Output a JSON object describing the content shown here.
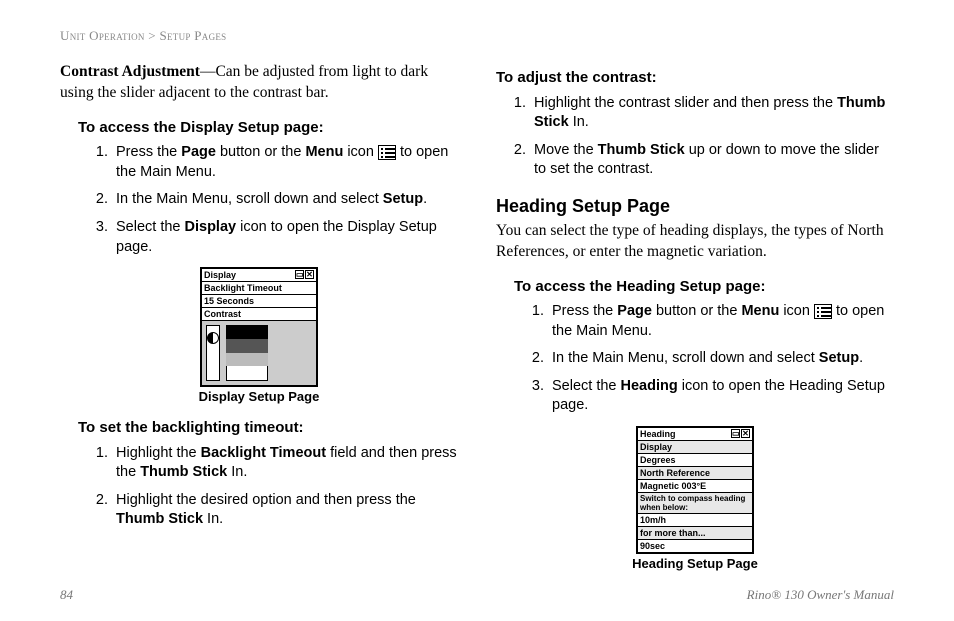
{
  "breadcrumb": {
    "a": "Unit Operation",
    "sep": " > ",
    "b": "Setup Pages"
  },
  "left": {
    "lead": "Contrast Adjustment",
    "lead_rest": "—Can be adjusted from light to dark using the slider adjacent to the contrast bar.",
    "proc1_head": "To access the Display Setup page:",
    "proc1": {
      "s1a": "Press the ",
      "s1b": "Page",
      "s1c": " button or the ",
      "s1d": "Menu",
      "s1e": " icon ",
      "s1f": " to open the Main Menu.",
      "s2a": "In the Main Menu, scroll down and select ",
      "s2b": "Setup",
      "s2c": ".",
      "s3a": "Select the ",
      "s3b": "Display",
      "s3c": " icon to open the Display Setup page."
    },
    "fig1_caption": "Display Setup Page",
    "display_mock": {
      "title": "Display",
      "row1": "Backlight Timeout",
      "row2": "15 Seconds",
      "row3": "Contrast"
    },
    "proc2_head": "To set the backlighting timeout:",
    "proc2": {
      "s1a": "Highlight the ",
      "s1b": "Backlight Timeout",
      "s1c": " field and then press the ",
      "s1d": "Thumb Stick",
      "s1e": " In.",
      "s2a": "Highlight the desired option and then press the ",
      "s2b": "Thumb Stick",
      "s2c": " In."
    }
  },
  "right": {
    "proc1_head": "To adjust the contrast:",
    "proc1": {
      "s1a": "Highlight the contrast slider and then press the ",
      "s1b": "Thumb Stick",
      "s1c": " In.",
      "s2a": "Move the ",
      "s2b": "Thumb Stick",
      "s2c": " up or down to move the slider to set the contrast."
    },
    "section_head": "Heading Setup Page",
    "section_body": "You can select the type of heading displays, the types of North References, or enter the magnetic variation.",
    "proc2_head": "To access the Heading Setup page:",
    "proc2": {
      "s1a": "Press the ",
      "s1b": "Page",
      "s1c": " button or the ",
      "s1d": "Menu",
      "s1e": " icon ",
      "s1f": " to open the Main Menu.",
      "s2a": "In the Main Menu, scroll down and select ",
      "s2b": "Setup",
      "s2c": ".",
      "s3a": "Select the ",
      "s3b": "Heading",
      "s3c": " icon to open the Heading Setup page."
    },
    "fig2_caption": "Heading Setup Page",
    "heading_mock": {
      "title": "Heading",
      "lbl1": "Display",
      "val1": "Degrees",
      "lbl2": "North Reference",
      "val2": "Magnetic      003°E",
      "lbl3": "Switch to compass heading when below:",
      "val3": "10m/h",
      "lbl4": "for more than...",
      "val4": "90sec"
    }
  },
  "footer": {
    "page": "84",
    "doc": "Rino® 130 Owner's Manual"
  }
}
